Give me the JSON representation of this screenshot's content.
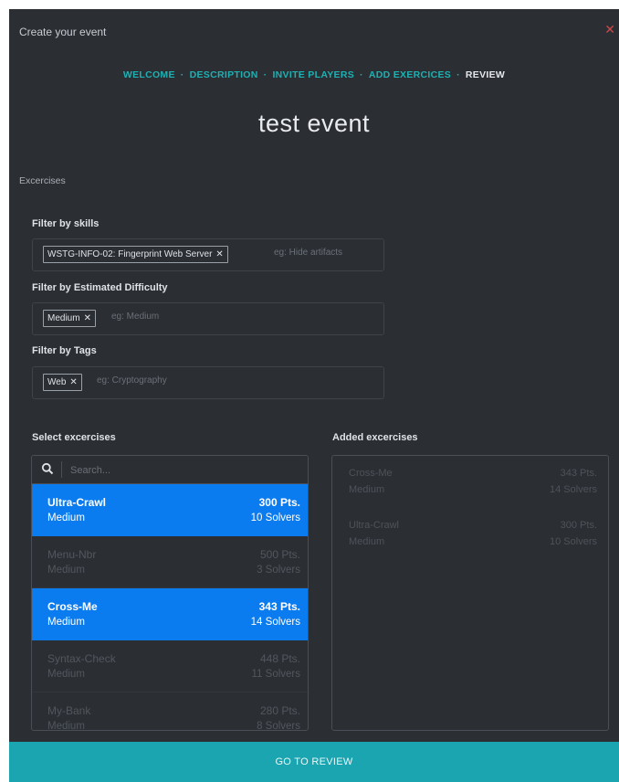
{
  "modal": {
    "title": "Create your event"
  },
  "steps": [
    {
      "label": "WELCOME"
    },
    {
      "label": "DESCRIPTION"
    },
    {
      "label": "INVITE PLAYERS"
    },
    {
      "label": "ADD EXERCICES"
    },
    {
      "label": "REVIEW"
    }
  ],
  "event_name": "test event",
  "section_label": "Excercises",
  "filters": {
    "skills": {
      "label": "Filter by skills",
      "tag": "WSTG-INFO-02: Fingerprint Web Server",
      "placeholder": "eg: Hide artifacts"
    },
    "difficulty": {
      "label": "Filter by Estimated Difficulty",
      "tag": "Medium",
      "placeholder": "eg: Medium"
    },
    "tags": {
      "label": "Filter by Tags",
      "tag": "Web",
      "placeholder": "eg: Cryptography"
    }
  },
  "select": {
    "label": "Select excercises",
    "search_placeholder": "Search...",
    "items": [
      {
        "name": "Ultra-Crawl",
        "difficulty": "Medium",
        "points": "300 Pts.",
        "solvers": "10 Solvers",
        "selected": true
      },
      {
        "name": "Menu-Nbr",
        "difficulty": "Medium",
        "points": "500 Pts.",
        "solvers": "3 Solvers",
        "selected": false
      },
      {
        "name": "Cross-Me",
        "difficulty": "Medium",
        "points": "343 Pts.",
        "solvers": "14 Solvers",
        "selected": true
      },
      {
        "name": "Syntax-Check",
        "difficulty": "Medium",
        "points": "448 Pts.",
        "solvers": "11 Solvers",
        "selected": false
      },
      {
        "name": "My-Bank",
        "difficulty": "Medium",
        "points": "280 Pts.",
        "solvers": "8 Solvers",
        "selected": false
      }
    ]
  },
  "added": {
    "label": "Added excercises",
    "items": [
      {
        "name": "Cross-Me",
        "difficulty": "Medium",
        "points": "343 Pts.",
        "solvers": "14 Solvers"
      },
      {
        "name": "Ultra-Crawl",
        "difficulty": "Medium",
        "points": "300 Pts.",
        "solvers": "10 Solvers"
      }
    ]
  },
  "footer": {
    "button_label": "GO TO REVIEW"
  },
  "colors": {
    "accent": "#1fb0b2",
    "selected": "#0b7cf0",
    "background": "#2b2e33",
    "footer": "#1ba5b1",
    "close": "#d0484b"
  }
}
